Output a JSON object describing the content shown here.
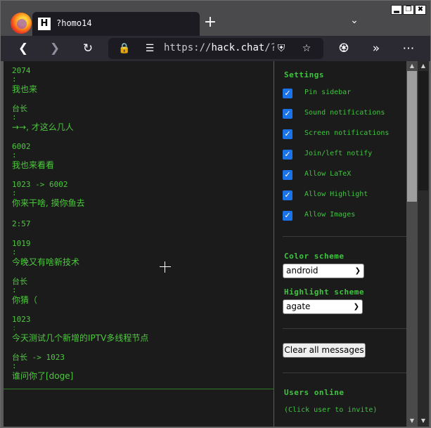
{
  "browser": {
    "tab_title": "?homo14",
    "tab_favicon": "H",
    "url_host": "hack.chat",
    "url_prefix": "https://",
    "url_suffix": "/?ho",
    "window_buttons": [
      "▂",
      "❐",
      "✖"
    ],
    "icons": [
      "firefox-logo",
      "back-icon",
      "forward-icon",
      "reload-icon",
      "lock-icon",
      "permissions-icon",
      "shield-icon",
      "bookmark-star-icon",
      "extensions-icon",
      "overflow-icon",
      "menu-icon"
    ]
  },
  "chat": {
    "messages": [
      {
        "nick": "2074",
        "text": "我也来"
      },
      {
        "nick": "台长",
        "text": "→→, 才这么几人"
      },
      {
        "nick": "6002",
        "text": "我也来看看"
      },
      {
        "nick": "1023 -> 6002",
        "text": "你来干啥, 摸你鱼去"
      },
      {
        "nick": "2:57",
        "text": ""
      },
      {
        "nick": "1019",
        "text": "今晚又有啥新技术"
      },
      {
        "nick": "台长",
        "text": "你猜（"
      },
      {
        "nick": "1023",
        "text": "今天测试几个新增的IPTV多线程节点"
      },
      {
        "nick": "台长 -> 1023",
        "text": "谁问你了[doge]"
      }
    ]
  },
  "sidebar": {
    "settings_title": "Settings",
    "options": [
      {
        "label": "Pin sidebar",
        "checked": true
      },
      {
        "label": "Sound notifications",
        "checked": true
      },
      {
        "label": "Screen notifications",
        "checked": true
      },
      {
        "label": "Join/left notify",
        "checked": true
      },
      {
        "label": "Allow LaTeX",
        "checked": true
      },
      {
        "label": "Allow Highlight",
        "checked": true
      },
      {
        "label": "Allow Images",
        "checked": true
      }
    ],
    "color_scheme_label": "Color scheme",
    "color_scheme_value": "android",
    "highlight_scheme_label": "Highlight scheme",
    "highlight_scheme_value": "agate",
    "clear_button": "Clear all messages",
    "users_online_title": "Users online",
    "invite_hint": "(Click user to invite)"
  },
  "colors": {
    "accent_green": "#4ec83f",
    "checkbox_blue": "#1a73e8"
  }
}
